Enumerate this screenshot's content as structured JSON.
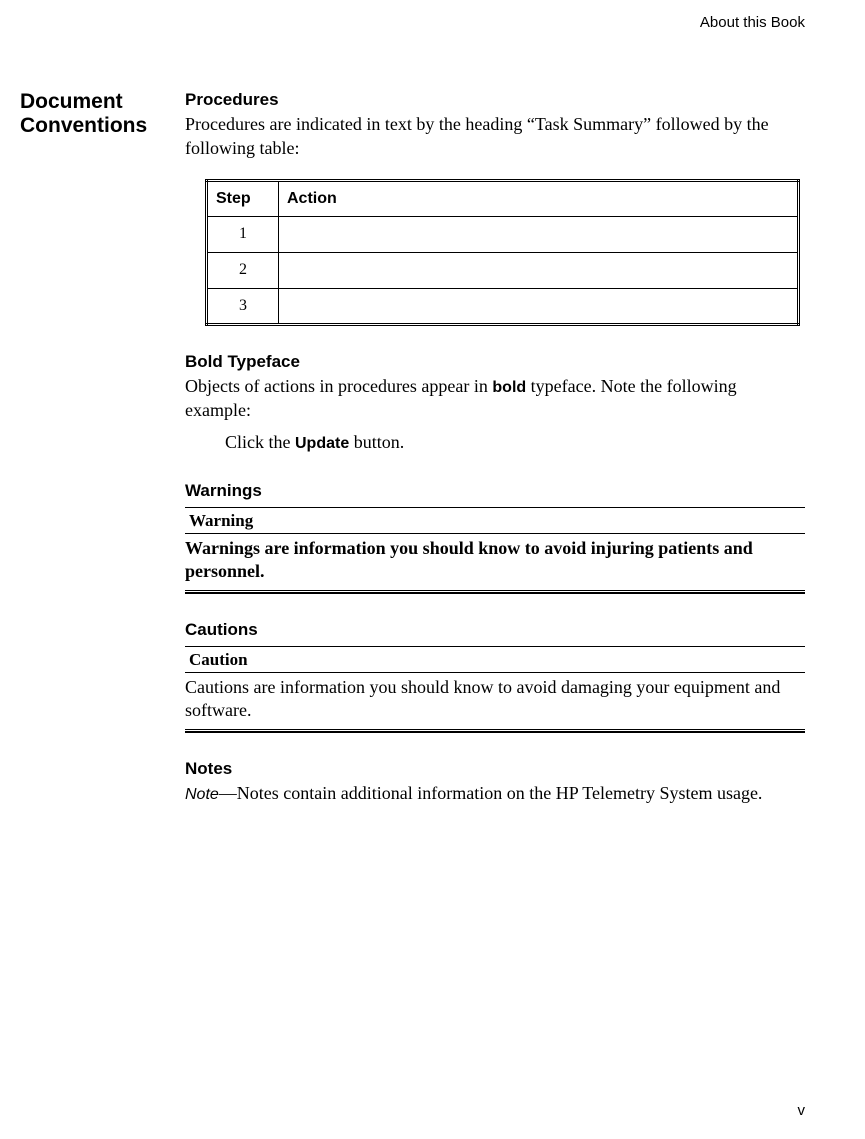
{
  "header_label": "About this Book",
  "sidebar_title1": "Document",
  "sidebar_title2": "Conventions",
  "procedures": {
    "heading": "Procedures",
    "body": "Procedures are indicated in text by the heading “Task Summary” followed by the following table:",
    "table": {
      "col1": "Step",
      "col2": "Action",
      "rows": [
        "1",
        "2",
        "3"
      ]
    }
  },
  "bold_typeface": {
    "heading": "Bold Typeface",
    "body_pre": "Objects of actions in procedures appear in ",
    "body_bold": "bold",
    "body_post": " typeface. Note the following example:",
    "example_pre": "Click the ",
    "example_bold": "Update",
    "example_post": " button."
  },
  "warnings": {
    "heading": "Warnings",
    "label": "Warning",
    "body": "Warnings are information you should know to avoid injuring patients and personnel."
  },
  "cautions": {
    "heading": "Cautions",
    "label": "Caution",
    "body": "Cautions are information you should know to avoid damaging your equipment and software."
  },
  "notes": {
    "heading": "Notes",
    "label": "Note",
    "dash": "—",
    "body": "Notes contain additional information on the HP Telemetry System usage."
  },
  "page_number": "v"
}
